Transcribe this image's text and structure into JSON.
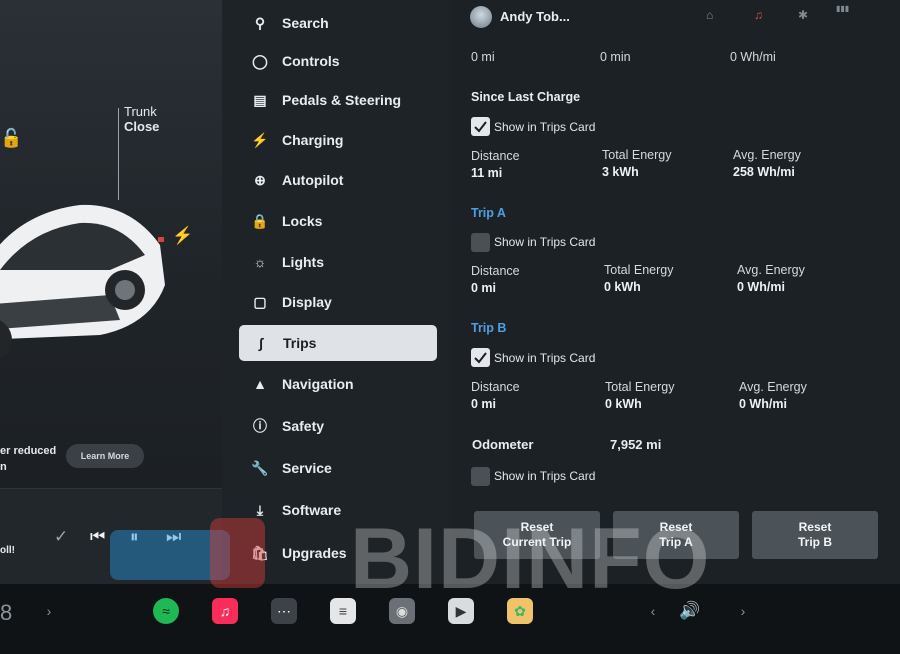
{
  "left_panel": {
    "trunk_label": "Trunk",
    "trunk_status": "Close",
    "notice_text": "er reduced",
    "notice_text2": "n",
    "learn_more": "Learn More",
    "song_text": "oll!"
  },
  "menu": {
    "items": [
      {
        "label": "Search",
        "icon": "search-icon"
      },
      {
        "label": "Controls",
        "icon": "toggle-icon"
      },
      {
        "label": "Pedals & Steering",
        "icon": "car-icon"
      },
      {
        "label": "Charging",
        "icon": "bolt-icon"
      },
      {
        "label": "Autopilot",
        "icon": "steering-wheel-icon"
      },
      {
        "label": "Locks",
        "icon": "lock-icon"
      },
      {
        "label": "Lights",
        "icon": "sun-icon"
      },
      {
        "label": "Display",
        "icon": "display-icon"
      },
      {
        "label": "Trips",
        "icon": "trips-icon"
      },
      {
        "label": "Navigation",
        "icon": "navigation-arrow-icon"
      },
      {
        "label": "Safety",
        "icon": "safety-icon"
      },
      {
        "label": "Service",
        "icon": "wrench-icon"
      },
      {
        "label": "Software",
        "icon": "download-icon"
      },
      {
        "label": "Upgrades",
        "icon": "shopping-bag-icon"
      }
    ],
    "active": "Trips"
  },
  "header": {
    "user_name": "Andy Tob..."
  },
  "top_row": {
    "distance": "0 mi",
    "duration": "0 min",
    "energy": "0 Wh/mi"
  },
  "since_last_charge": {
    "title": "Since Last Charge",
    "show_label": "Show in Trips Card",
    "checked": true,
    "distance_label": "Distance",
    "distance": "11 mi",
    "total_energy_label": "Total Energy",
    "total_energy": "3 kWh",
    "avg_energy_label": "Avg. Energy",
    "avg_energy": "258 Wh/mi"
  },
  "trip_a": {
    "title": "Trip A",
    "show_label": "Show in Trips Card",
    "checked": false,
    "distance_label": "Distance",
    "distance": "0 mi",
    "total_energy_label": "Total Energy",
    "total_energy": "0 kWh",
    "avg_energy_label": "Avg. Energy",
    "avg_energy": "0 Wh/mi"
  },
  "trip_b": {
    "title": "Trip B",
    "show_label": "Show in Trips Card",
    "checked": true,
    "distance_label": "Distance",
    "distance": "0 mi",
    "total_energy_label": "Total Energy",
    "total_energy": "0 kWh",
    "avg_energy_label": "Avg. Energy",
    "avg_energy": "0 Wh/mi"
  },
  "odometer": {
    "label": "Odometer",
    "value": "7,952 mi",
    "show_label": "Show in Trips Card",
    "checked": false
  },
  "reset_buttons": {
    "current_line1": "Reset",
    "current_line2": "Current Trip",
    "a_line1": "Reset",
    "a_line2": "Trip A",
    "b_line1": "Reset",
    "b_line2": "Trip B"
  },
  "dock": {
    "temp": "8",
    "apps": [
      "spotify-icon",
      "music-icon",
      "more-icon",
      "notes-icon",
      "camera-icon",
      "video-icon",
      "photos-icon",
      "volume-icon"
    ]
  },
  "watermark": "BIDINFO",
  "colors": {
    "accent_blue": "#4f9fe0",
    "active_menu_bg": "#dfe3e7",
    "button_bg": "#4b5258"
  }
}
